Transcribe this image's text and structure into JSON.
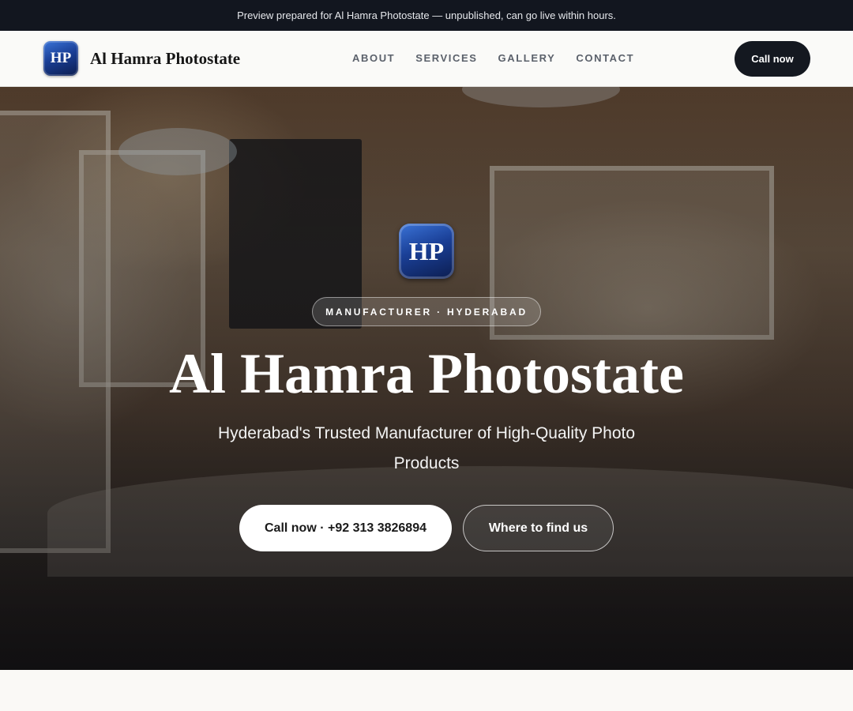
{
  "banner": {
    "text": "Preview prepared for Al Hamra Photostate — unpublished, can go live within hours."
  },
  "nav": {
    "logo_text": "HP",
    "brand_name": "Al Hamra Photostate",
    "links": [
      "ABOUT",
      "SERVICES",
      "GALLERY",
      "CONTACT"
    ],
    "call_label": "Call now"
  },
  "hero": {
    "logo_text": "HP",
    "tag": "MANUFACTURER · HYDERABAD",
    "title": "Al Hamra Photostate",
    "subtitle": "Hyderabad's Trusted Manufacturer of High-Quality Photo Products",
    "primary_button": "Call now · +92 313 3826894",
    "secondary_button": "Where to find us"
  },
  "colors": {
    "banner_bg": "#12161f",
    "accent_dark": "#141820",
    "logo_blue": "#1a3f96"
  }
}
